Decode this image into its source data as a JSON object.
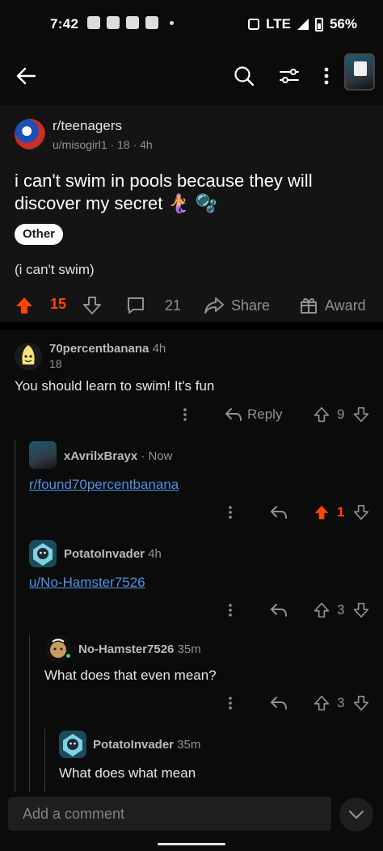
{
  "status_bar": {
    "time": "7:42",
    "network": "LTE",
    "battery": "56%"
  },
  "post": {
    "subreddit": "r/teenagers",
    "meta": "u/misogirl1 · 18 · 4h",
    "title": "i can't swim in pools because they will discover my secret",
    "title_emoji": "🧜‍♀️ 🫧",
    "flair": "Other",
    "body": "(i can't swim)",
    "upvotes": "15",
    "comments": "21",
    "share_label": "Share",
    "award_label": "Award"
  },
  "comments": [
    {
      "author": "70percentbanana",
      "age": "4h",
      "score": "18",
      "text": "You should learn to swim! It's fun",
      "reply_label": "Reply",
      "votes": "9"
    },
    {
      "author": "xAvrilxBrayx",
      "age": "· Now",
      "text": "r/found70percentbanana",
      "votes": "1"
    },
    {
      "author": "PotatoInvader",
      "age": "4h",
      "text": "u/No-Hamster7526",
      "votes": "3"
    },
    {
      "author": "No-Hamster7526",
      "age": "35m",
      "text": "What does that even mean?",
      "votes": "3"
    },
    {
      "author": "PotatoInvader",
      "age": "35m",
      "text": "What does what mean"
    }
  ],
  "composer": {
    "placeholder": "Add a comment"
  },
  "colors": {
    "accent": "#ff4500",
    "link": "#4f93e6",
    "background": "#0b0b0b"
  }
}
